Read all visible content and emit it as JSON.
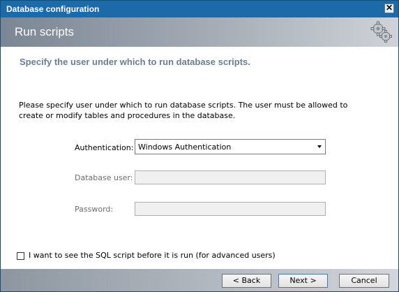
{
  "window": {
    "title": "Database configuration",
    "close_glyph": "✕"
  },
  "header": {
    "title": "Run scripts",
    "icon": "gears-icon"
  },
  "subtitle": "Specify the user under which to run database scripts.",
  "description": "Please specify user under which to run database scripts. The user must be allowed to create or modify tables and procedures in the database.",
  "form": {
    "authentication_label": "Authentication:",
    "authentication_value": "Windows Authentication",
    "db_user_label": "Database user:",
    "db_user_value": "",
    "password_label": "Password:",
    "password_value": ""
  },
  "checkbox": {
    "label": "I want to see the SQL script before it is run (for advanced users)",
    "checked": false
  },
  "buttons": {
    "back": "< Back",
    "next": "Next >",
    "cancel": "Cancel"
  },
  "colors": {
    "titlebar": "#1d6aa8",
    "subtitle": "#6a7e92"
  }
}
